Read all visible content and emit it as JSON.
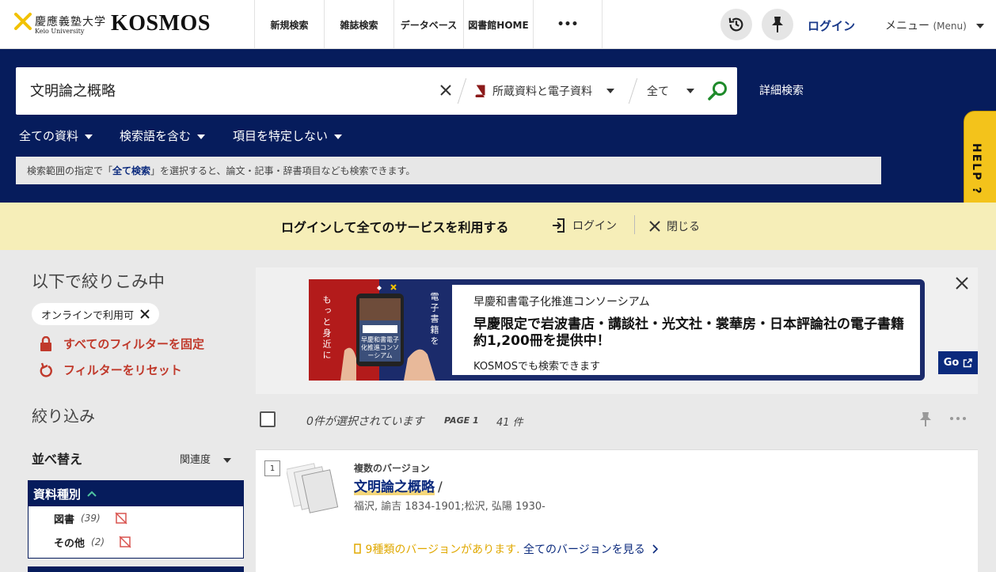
{
  "header": {
    "logo_jp": "慶應義塾大学",
    "logo_en": "Keio University",
    "logo_name": "KOSMOS",
    "nav": [
      "新規検索",
      "雑誌検索",
      "データベース",
      "図書館HOME"
    ],
    "more": "•••",
    "login": "ログイン",
    "menu": "メニュー",
    "menu_sub": "(Menu)"
  },
  "search": {
    "query": "文明論之概略",
    "scope": "所蔵資料と電子資料",
    "field": "全て",
    "advanced": "詳細検索",
    "filters": [
      "全ての資料",
      "検索語を含む",
      "項目を特定しない"
    ],
    "hint_pre": "検索範囲の指定で「",
    "hint_bold": "全て検索",
    "hint_post": "」を選択すると、論文・記事・辞書項目なども検索できます。"
  },
  "help": "HELP ?",
  "login_banner": {
    "text": "ログインして全てのサービスを利用する",
    "login": "ログイン",
    "close": "閉じる"
  },
  "sidebar": {
    "refine_title": "以下で絞りこみ中",
    "chip": "オンラインで利用可",
    "lock_filters": "すべてのフィルターを固定",
    "reset_filters": "フィルターをリセット",
    "narrow_title": "絞り込み",
    "sort_label": "並べ替え",
    "sort_value": "関連度",
    "facet_title": "資料種別",
    "facet_items": [
      {
        "label": "図書",
        "count": "(39)"
      },
      {
        "label": "その他",
        "count": "(2)"
      }
    ]
  },
  "promo": {
    "image_left_text": "もっと身近に",
    "image_right_text": "電子書籍を",
    "image_mid_text": "早慶和書電子化推進コンソーシアム",
    "line1": "早慶和書電子化推進コンソーシアム",
    "line2": "早慶限定で岩波書店・講談社・光文社・裳華房・日本評論社の電子書籍 約1,200冊を提供中！",
    "line3": "KOSMOSでも検索できます",
    "go": "Go"
  },
  "results_bar": {
    "selected": "0件が選択されています",
    "page": "PAGE 1",
    "total": "41 件"
  },
  "result": {
    "number": "1",
    "multi": "複数のバージョン",
    "title": "文明論之概略",
    "title_suffix": "/",
    "author": "福沢, 諭吉 1834-1901;松沢, 弘陽 1930-",
    "versions_highlight": "9種類のバージョンがあります.",
    "versions_link": "全てのバージョンを見る"
  },
  "colors": {
    "navy": "#061c5c",
    "login_banner": "#f6eeb8",
    "help": "#f3c31b",
    "filter_red": "#c0392b",
    "link_blue": "#0b2a7d"
  }
}
